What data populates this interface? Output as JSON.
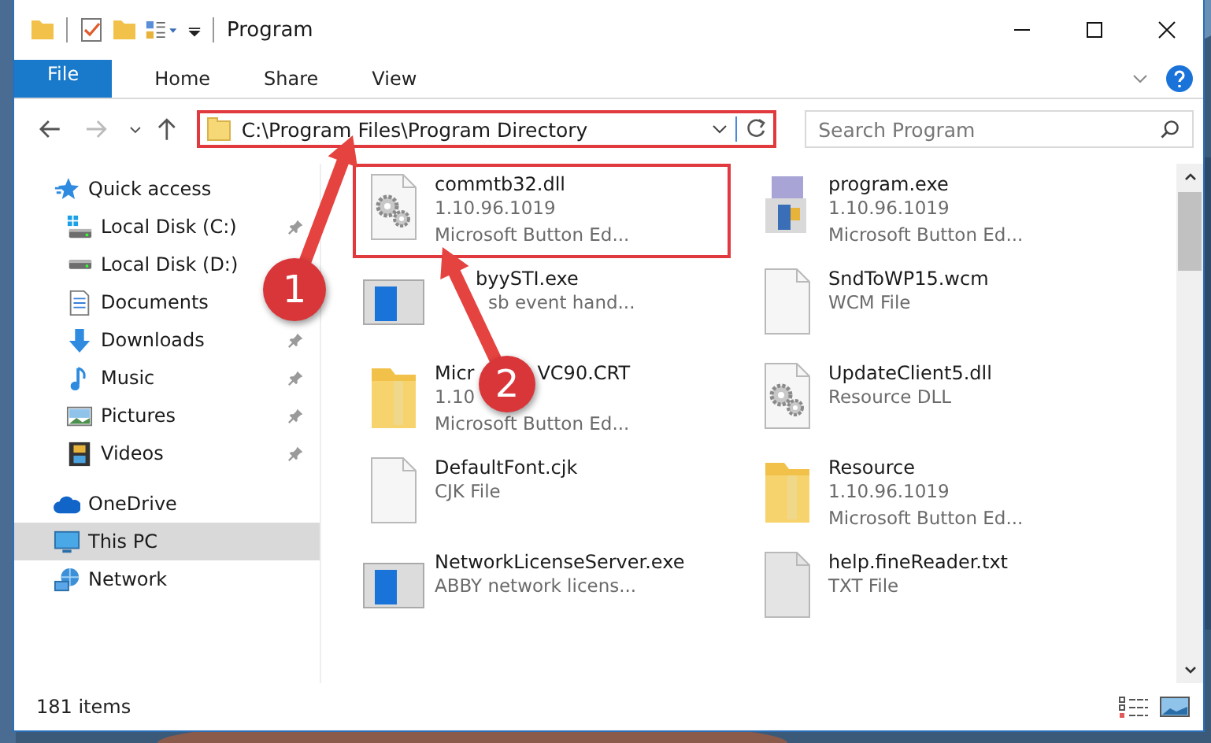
{
  "window": {
    "title": "Program"
  },
  "ribbon": {
    "tabs": [
      {
        "label": "File",
        "kind": "file"
      },
      {
        "label": "Home",
        "kind": "tab"
      },
      {
        "label": "Share",
        "kind": "tab"
      },
      {
        "label": "View",
        "kind": "tab"
      }
    ]
  },
  "address_bar": {
    "path": "C:\\Program Files\\Program Directory",
    "highlighted": true
  },
  "search": {
    "placeholder": "Search Program"
  },
  "sidebar": {
    "items": [
      {
        "label": "Quick access",
        "kind": "star",
        "selected": false,
        "children": [
          {
            "label": "Local Disk (C:)",
            "kind": "drive-win",
            "pinned": true,
            "selected": false
          },
          {
            "label": "Local Disk (D:)",
            "kind": "drive",
            "pinned": false,
            "selected": false
          },
          {
            "label": "Documents",
            "kind": "document",
            "pinned": false,
            "selected": false
          },
          {
            "label": "Downloads",
            "kind": "download",
            "pinned": true,
            "selected": false
          },
          {
            "label": "Music",
            "kind": "music",
            "pinned": true,
            "selected": false
          },
          {
            "label": "Pictures",
            "kind": "pictures",
            "pinned": true,
            "selected": false
          },
          {
            "label": "Videos",
            "kind": "film",
            "pinned": true,
            "selected": false
          }
        ]
      },
      {
        "label": "OneDrive",
        "kind": "cloud",
        "selected": false
      },
      {
        "label": "This PC",
        "kind": "monitor",
        "selected": true
      },
      {
        "label": "Network",
        "kind": "network",
        "selected": false
      }
    ]
  },
  "files": [
    {
      "name": [
        "commtb32.dll"
      ],
      "details": [
        "1.10.96.1019",
        "Microsoft Button Ed..."
      ],
      "kind": "gear-file",
      "highlighted": true
    },
    {
      "name": [
        "program.exe"
      ],
      "details": [
        "1.10.96.1019",
        "Microsoft Button Ed..."
      ],
      "kind": "installer",
      "highlighted": false
    },
    {
      "name": [
        "byySTI.exe"
      ],
      "details": [
        "sb event hand..."
      ],
      "kind": "app-window",
      "highlighted": false
    },
    {
      "name": [
        "SndToWP15.wcm"
      ],
      "details": [
        "WCM File"
      ],
      "kind": "blank-file",
      "highlighted": false
    },
    {
      "name": [
        "Micr",
        "VC90.CRT"
      ],
      "details": [
        "1.10",
        "Microsoft Button Ed..."
      ],
      "kind": "folder",
      "highlighted": false
    },
    {
      "name": [
        "UpdateClient5.dll"
      ],
      "details": [
        "Resource DLL"
      ],
      "kind": "gear-file",
      "highlighted": false
    },
    {
      "name": [
        "DefaultFont.cjk"
      ],
      "details": [
        "CJK File"
      ],
      "kind": "blank-file",
      "highlighted": false
    },
    {
      "name": [
        "Resource"
      ],
      "details": [
        "1.10.96.1019",
        "Microsoft Button Ed..."
      ],
      "kind": "folder",
      "highlighted": false
    },
    {
      "name": [
        "NetworkLicenseServer.exe"
      ],
      "details": [
        "ABBY network licens..."
      ],
      "kind": "app-window",
      "highlighted": false
    },
    {
      "name": [
        "help.fineReader.txt"
      ],
      "details": [
        "TXT File"
      ],
      "kind": "grey-file",
      "highlighted": false
    }
  ],
  "callouts": [
    {
      "number": "1"
    },
    {
      "number": "2"
    }
  ],
  "status_bar": {
    "item_count": "181 items"
  }
}
